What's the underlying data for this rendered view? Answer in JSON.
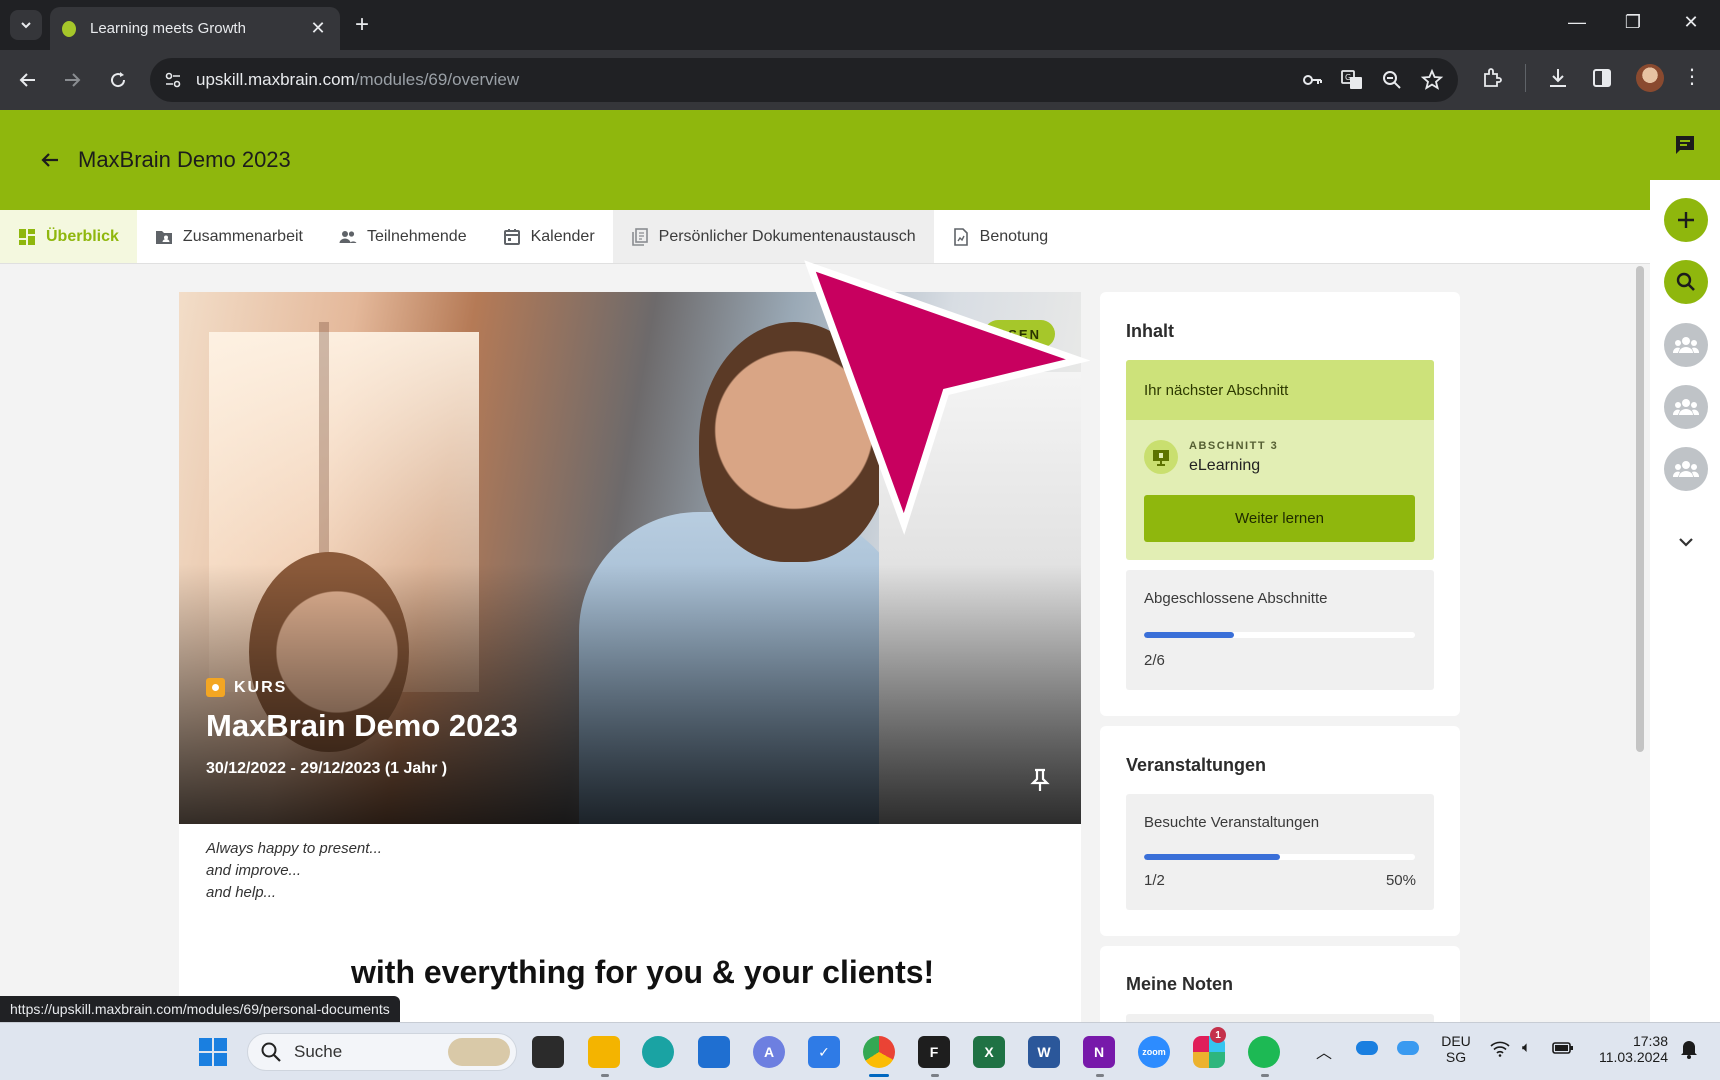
{
  "browser": {
    "tab_title": "Learning meets Growth",
    "url_host": "upskill.maxbrain.com",
    "url_path": "/modules/69/overview",
    "status_url": "https://upskill.maxbrain.com/modules/69/personal-documents"
  },
  "header": {
    "title": "MaxBrain Demo 2023"
  },
  "tabs": [
    {
      "label": "Überblick",
      "icon": "dashboard-icon"
    },
    {
      "label": "Zusammenarbeit",
      "icon": "folder-shared-icon"
    },
    {
      "label": "Teilnehmende",
      "icon": "people-icon"
    },
    {
      "label": "Kalender",
      "icon": "calendar-icon"
    },
    {
      "label": "Persönlicher Dokumentenaustausch",
      "icon": "documents-icon"
    },
    {
      "label": "Benotung",
      "icon": "grade-document-icon"
    }
  ],
  "hero": {
    "badge": "SSEN",
    "kind": "KURS",
    "title": "MaxBrain Demo 2023",
    "dates": "30/12/2022 - 29/12/2023 (1 Jahr )"
  },
  "description": {
    "lines": [
      "Always happy to present...",
      "and improve...",
      "and help..."
    ],
    "headline": "with everything for you & your clients!"
  },
  "inhalt": {
    "title": "Inhalt",
    "next_heading": "Ihr nächster Abschnitt",
    "section_overline": "ABSCHNITT 3",
    "section_name": "eLearning",
    "continue_label": "Weiter lernen",
    "completed_label": "Abgeschlossene Abschnitte",
    "completed_value": "2/6",
    "completed_fraction": 0.333
  },
  "events": {
    "title": "Veranstaltungen",
    "visited_label": "Besuchte Veranstaltungen",
    "visited_value": "1/2",
    "visited_percent": "50%",
    "visited_fraction": 0.5
  },
  "grades": {
    "title": "Meine Noten"
  },
  "taskbar": {
    "search_placeholder": "Suche",
    "lang_1": "DEU",
    "lang_2": "SG",
    "time": "17:38",
    "date": "11.03.2024",
    "slack_badge": "1"
  },
  "colors": {
    "brand_green": "#8fb70d",
    "accent_pink": "#c8005f",
    "progress_blue": "#3a6fd8"
  }
}
